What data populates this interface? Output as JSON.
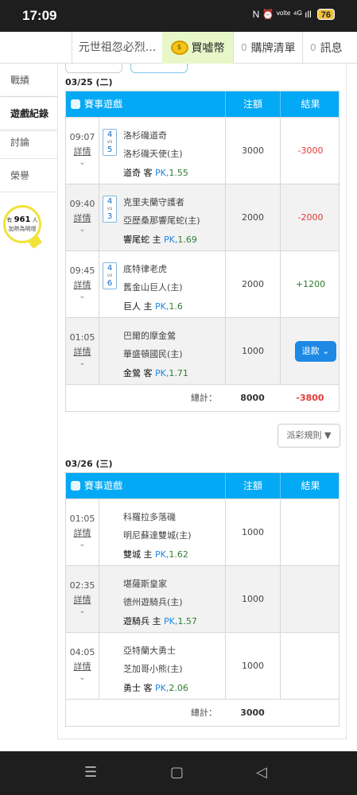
{
  "status_bar": {
    "time": "17:09",
    "icons": "N ⏰ ᵛᵒˡᵗᵉ ⁴ᴳ ıll",
    "battery": "76"
  },
  "top_nav": {
    "title": "元世祖忽必烈...",
    "buy": "買嘘幣",
    "coin_text": "$",
    "tabs": [
      {
        "count": "0",
        "label": "購牌清單"
      },
      {
        "count": "0",
        "label": "訊息"
      }
    ]
  },
  "sidebar": {
    "items": [
      {
        "label": "戰績"
      },
      {
        "label": "遊戲紀錄"
      },
      {
        "label": "討論"
      },
      {
        "label": "榮譽"
      }
    ],
    "bulb_prefix": "有",
    "bulb_count": "961",
    "bulb_unit": "人",
    "bulb_caption": "加熱為明燈"
  },
  "headers": {
    "game": "賽事遊戲",
    "bet": "注額",
    "result": "結果"
  },
  "total_label": "總計：",
  "refund_label": "退款",
  "rules_button": "派彩規則 ▼",
  "days": [
    {
      "date": "03/25 (二)",
      "games": [
        {
          "time": "09:07",
          "detail": "詳情",
          "score1": "4",
          "score2": "5",
          "vs": "vs",
          "team1": "洛杉磯道奇",
          "team2": "洛杉磯天使(主)",
          "pick_team": "道奇",
          "pick_side": "客",
          "pick_type": "PK,",
          "pick_odds": "1.55",
          "bet": "3000",
          "result": "-3000",
          "result_class": "neg"
        },
        {
          "time": "09:40",
          "detail": "詳情",
          "score1": "4",
          "score2": "3",
          "vs": "vs",
          "team1": "克里夫蘭守護者",
          "team2": "亞歷桑那響尾蛇(主)",
          "pick_team": "響尾蛇",
          "pick_side": "主",
          "pick_type": "PK,",
          "pick_odds": "1.69",
          "bet": "2000",
          "result": "-2000",
          "result_class": "neg"
        },
        {
          "time": "09:45",
          "detail": "詳情",
          "score1": "4",
          "score2": "6",
          "vs": "vs",
          "team1": "底特律老虎",
          "team2": "舊金山巨人(主)",
          "pick_team": "巨人",
          "pick_side": "主",
          "pick_type": "PK,",
          "pick_odds": "1.6",
          "bet": "2000",
          "result": "+1200",
          "result_class": "pos"
        },
        {
          "time": "01:05",
          "detail": "詳情",
          "score1": "",
          "score2": "",
          "vs": "",
          "team1": "巴爾的摩金鶯",
          "team2": "華盛頓國民(主)",
          "pick_team": "金鶯",
          "pick_side": "客",
          "pick_type": "PK,",
          "pick_odds": "1.71",
          "bet": "1000",
          "result": "",
          "result_class": "",
          "refund": true
        }
      ],
      "total_bet": "8000",
      "total_result": "-3800"
    },
    {
      "date": "03/26 (三)",
      "games": [
        {
          "time": "01:05",
          "detail": "詳情",
          "score1": "",
          "score2": "",
          "vs": "",
          "team1": "科羅拉多落磯",
          "team2": "明尼蘇達雙城(主)",
          "pick_team": "雙城",
          "pick_side": "主",
          "pick_type": "PK,",
          "pick_odds": "1.62",
          "bet": "1000",
          "result": "",
          "result_class": ""
        },
        {
          "time": "02:35",
          "detail": "詳情",
          "score1": "",
          "score2": "",
          "vs": "",
          "team1": "堪薩斯皇家",
          "team2": "德州遊騎兵(主)",
          "pick_team": "遊騎兵",
          "pick_side": "主",
          "pick_type": "PK,",
          "pick_odds": "1.57",
          "bet": "1000",
          "result": "",
          "result_class": ""
        },
        {
          "time": "04:05",
          "detail": "詳情",
          "score1": "",
          "score2": "",
          "vs": "",
          "team1": "亞特蘭大勇士",
          "team2": "芝加哥小熊(主)",
          "pick_team": "勇士",
          "pick_side": "客",
          "pick_type": "PK,",
          "pick_odds": "2.06",
          "bet": "1000",
          "result": "",
          "result_class": ""
        }
      ],
      "total_bet": "3000",
      "total_result": ""
    }
  ],
  "bottom_nav": {
    "menu": "☰",
    "home": "▢",
    "back": "◁"
  }
}
